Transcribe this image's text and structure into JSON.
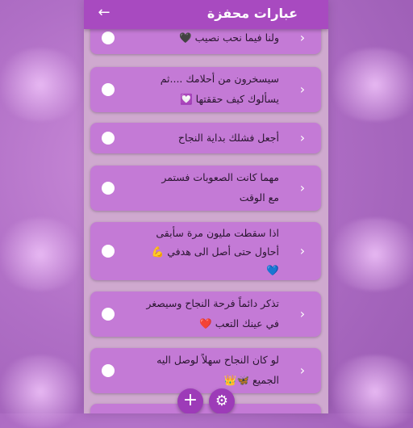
{
  "app": {
    "title": "عبارات محفزة",
    "back_icon": "arrow-back-icon"
  },
  "items": [
    {
      "text": "ولنا فيما نحب نصيب 🖤"
    },
    {
      "text": "سيسخرون من أحلامك ....ثم\nيسألوك كيف حققتها 💟"
    },
    {
      "text": "أجعل فشلك بداية النجاح"
    },
    {
      "text": "مهما كانت الصعوبات فستمر\nمع الوقت"
    },
    {
      "text": "اذا سقطت مليون مرة سأبقى\nأحاول حتى أصل الى هدفي 💪\n💙"
    },
    {
      "text": "تذكر دائماً فرحة النجاح وسيصغر\nفي عينك التعب ❤️"
    },
    {
      "text": "لو كان النجاح سهلاً لوصل اليه\nالجميع 🦋👑"
    },
    {
      "text": ""
    }
  ],
  "fabs": {
    "add_icon": "plus-icon",
    "settings_icon": "gear-icon"
  },
  "colors": {
    "appbar": "#a84ac0",
    "card": "#c47ad6",
    "fab": "#9d3bb8"
  }
}
